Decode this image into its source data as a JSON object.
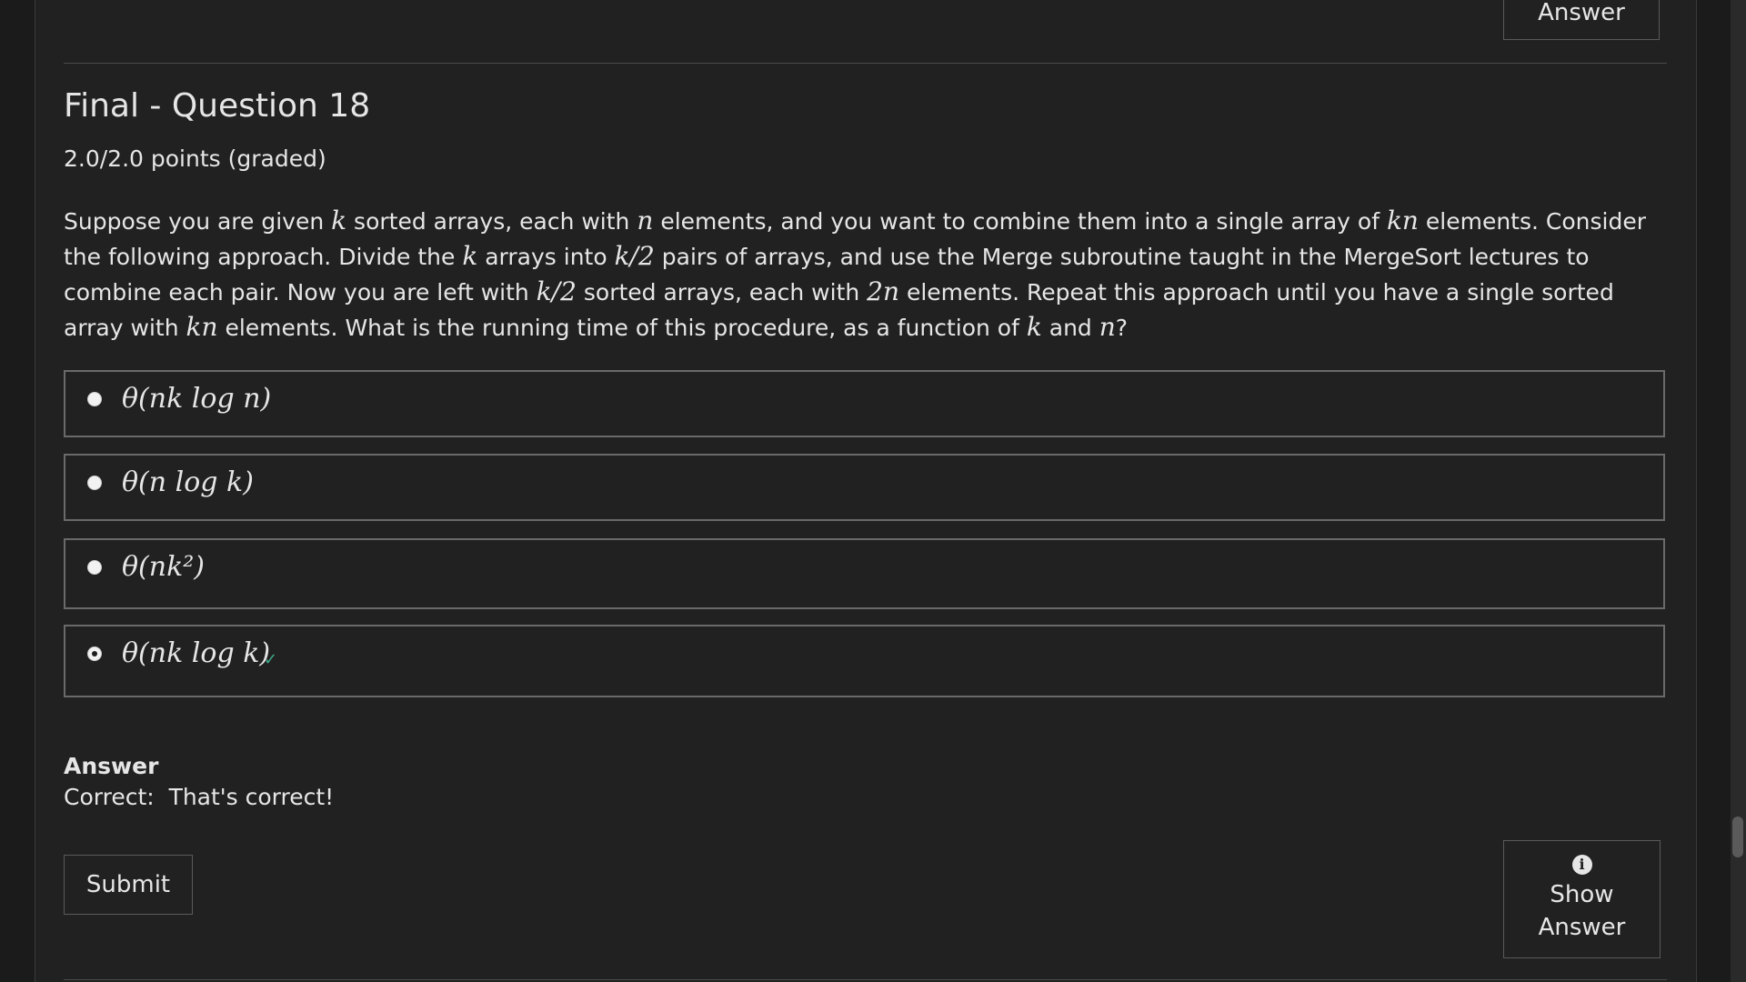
{
  "top_button": {
    "label": "Answer"
  },
  "problem": {
    "title": "Final - Question 18",
    "points": "2.0/2.0 points (graded)",
    "question_parts": {
      "p1": "Suppose you are given ",
      "m1": "k",
      "p2": " sorted arrays, each with ",
      "m2": "n",
      "p3": " elements, and you want to combine them into a single array of ",
      "m3": "kn",
      "p4": " elements. Consider the following approach. Divide the ",
      "m4": "k",
      "p5": " arrays into ",
      "m5": "k/2",
      "p6": " pairs of arrays, and use the Merge subroutine taught in the MergeSort lectures to combine each pair. Now you are left with ",
      "m6": "k/2",
      "p7": " sorted arrays, each with ",
      "m7": "2n",
      "p8": " elements. Repeat this approach until you have a single sorted array with ",
      "m8": "kn",
      "p9": " elements. What is the running time of this procedure, as a function of ",
      "m9": "k",
      "p10": " and ",
      "m10": "n",
      "p11": "?"
    },
    "choices": [
      {
        "label": "θ(nk log n)",
        "selected": false
      },
      {
        "label": "θ(n log k)",
        "selected": false
      },
      {
        "label": "θ(nk²)",
        "selected": false
      },
      {
        "label": "θ(nk log k)",
        "selected": true,
        "status_icon": "check-icon",
        "status_color": "#3daa8c"
      }
    ],
    "answer": {
      "heading": "Answer",
      "text": "Correct:  That's correct!"
    },
    "submit_label": "Submit",
    "show_answer": {
      "line1": "Show",
      "line2": "Answer",
      "icon": "info-icon"
    }
  }
}
